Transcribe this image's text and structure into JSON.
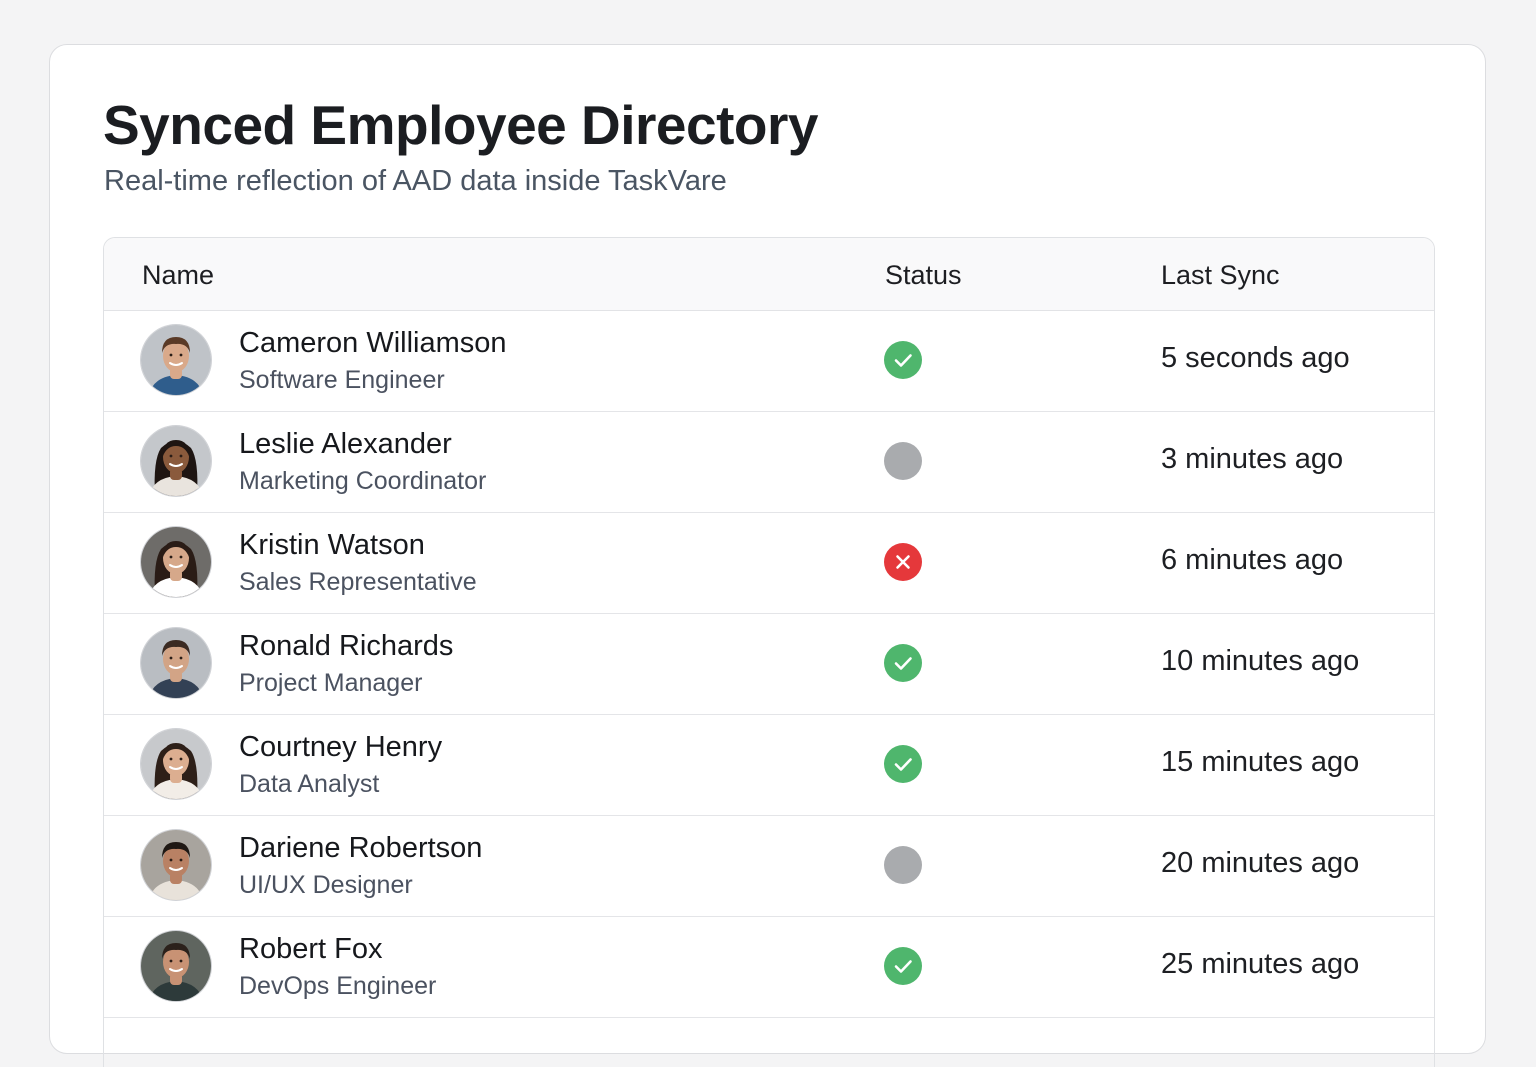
{
  "page": {
    "title": "Synced Employee Directory",
    "subtitle": "Real-time reflection of AAD data inside TaskVare"
  },
  "table": {
    "headers": {
      "name": "Name",
      "status": "Status",
      "last_sync": "Last Sync"
    },
    "rows": [
      {
        "name": "Cameron Williamson",
        "role": "Software Engineer",
        "status": "success",
        "last_sync": "5 seconds ago",
        "avatar": {
          "skin": "#d9a98a",
          "hair": "#5a3a26",
          "shirt": "#2f5d8c",
          "bg": "#bfc3c8",
          "long_hair": false
        }
      },
      {
        "name": "Leslie Alexander",
        "role": "Marketing Coordinator",
        "status": "pending",
        "last_sync": "3 minutes ago",
        "avatar": {
          "skin": "#8a5a3c",
          "hair": "#1e1512",
          "shirt": "#e9e4de",
          "bg": "#c4c7cb",
          "long_hair": true
        }
      },
      {
        "name": "Kristin Watson",
        "role": "Sales Representative",
        "status": "error",
        "last_sync": "6 minutes ago",
        "avatar": {
          "skin": "#d6a88a",
          "hair": "#2a1c16",
          "shirt": "#ffffff",
          "bg": "#6e6c69",
          "long_hair": true
        }
      },
      {
        "name": "Ronald Richards",
        "role": "Project Manager",
        "status": "success",
        "last_sync": "10 minutes ago",
        "avatar": {
          "skin": "#d2a486",
          "hair": "#3a2a22",
          "shirt": "#334155",
          "bg": "#b9bdc2",
          "long_hair": false
        }
      },
      {
        "name": "Courtney Henry",
        "role": "Data Analyst",
        "status": "success",
        "last_sync": "15 minutes ago",
        "avatar": {
          "skin": "#dcae90",
          "hair": "#2d1f18",
          "shirt": "#f2ede7",
          "bg": "#c7c9cc",
          "long_hair": true
        }
      },
      {
        "name": "Dariene Robertson",
        "role": "UI/UX Designer",
        "status": "pending",
        "last_sync": "20 minutes ago",
        "avatar": {
          "skin": "#b98164",
          "hair": "#1f1814",
          "shirt": "#e8e2da",
          "bg": "#a8a49e",
          "long_hair": false
        }
      },
      {
        "name": "Robert Fox",
        "role": "DevOps Engineer",
        "status": "success",
        "last_sync": "25 minutes ago",
        "avatar": {
          "skin": "#c89274",
          "hair": "#2b211b",
          "shirt": "#2d3a3a",
          "bg": "#5f655f",
          "long_hair": false
        }
      }
    ]
  },
  "status_colors": {
    "success": "#4fb66d",
    "pending": "#a9abae",
    "error": "#e5383b"
  },
  "icons": {
    "success": "check-icon",
    "error": "close-icon",
    "pending": "status-dot"
  }
}
